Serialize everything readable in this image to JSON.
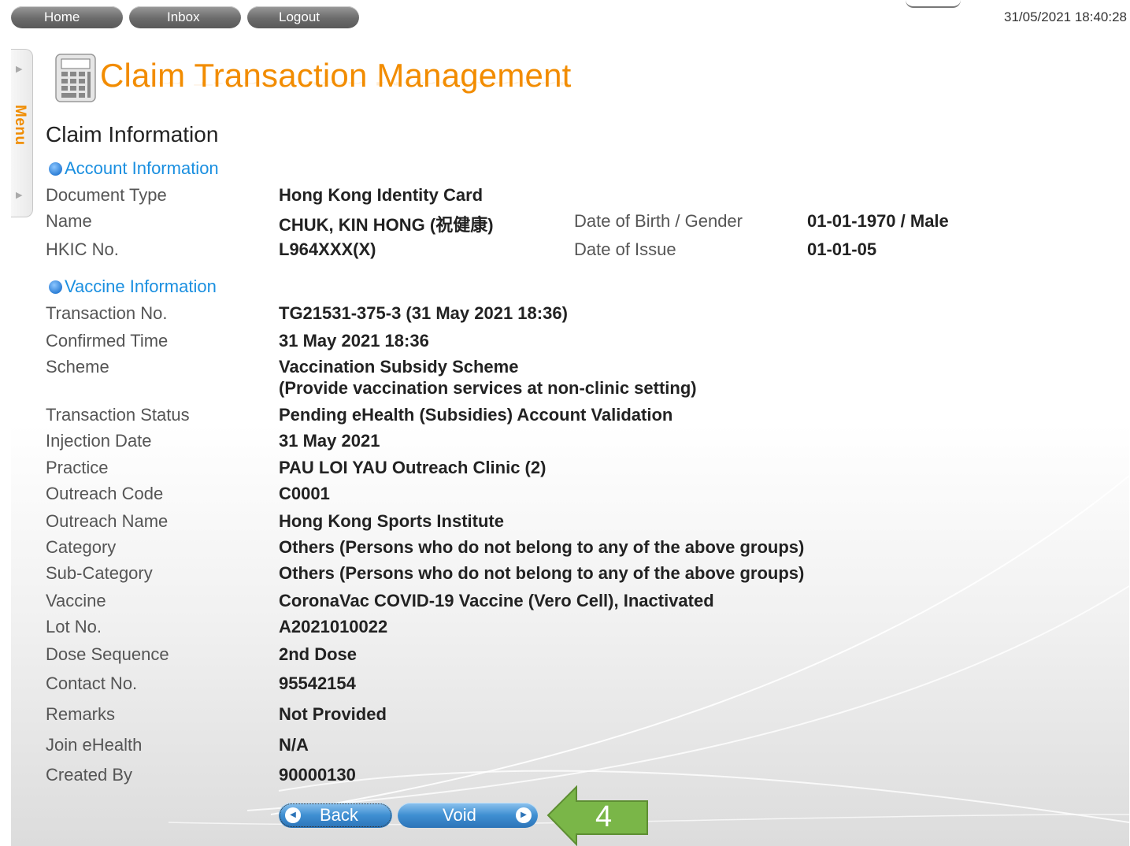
{
  "nav": {
    "home": "Home",
    "inbox": "Inbox",
    "logout": "Logout"
  },
  "datetime": "31/05/2021 18:40:28",
  "menu": {
    "label": "Menu"
  },
  "page_title": "Claim Transaction Management",
  "section": "Claim Information",
  "account": {
    "heading": "Account Information",
    "document_type_label": "Document Type",
    "document_type": "Hong Kong Identity Card",
    "name_label": "Name",
    "name": "CHUK, KIN HONG (祝健康)",
    "dob_gender_label": "Date of Birth / Gender",
    "dob_gender": "01-01-1970 / Male",
    "hkic_label": "HKIC No.",
    "hkic": "L964XXX(X)",
    "doi_label": "Date of Issue",
    "doi": "01-01-05"
  },
  "vaccine": {
    "heading": "Vaccine Information",
    "transaction_no_label": "Transaction No.",
    "transaction_no": "TG21531-375-3 (31 May 2021 18:36)",
    "confirmed_time_label": "Confirmed Time",
    "confirmed_time": "31 May 2021 18:36",
    "scheme_label": "Scheme",
    "scheme_line1": "Vaccination Subsidy Scheme",
    "scheme_line2": "(Provide vaccination services at non-clinic setting)",
    "status_label": "Transaction Status",
    "status": "Pending eHealth (Subsidies) Account Validation",
    "injection_date_label": "Injection Date",
    "injection_date": "31 May 2021",
    "practice_label": "Practice",
    "practice": "PAU LOI YAU Outreach Clinic (2)",
    "outreach_code_label": "Outreach Code",
    "outreach_code": "C0001",
    "outreach_name_label": "Outreach Name",
    "outreach_name": "Hong Kong Sports Institute",
    "category_label": "Category",
    "category": "Others (Persons who do not belong to any of the above groups)",
    "subcategory_label": "Sub-Category",
    "subcategory": "Others (Persons who do not belong to any of the above groups)",
    "vaccine_label": "Vaccine",
    "vaccine": "CoronaVac COVID-19 Vaccine (Vero Cell), Inactivated",
    "lot_label": "Lot No.",
    "lot": "A2021010022",
    "dose_label": "Dose Sequence",
    "dose": "2nd Dose",
    "contact_label": "Contact No.",
    "contact": "95542154",
    "remarks_label": "Remarks",
    "remarks": "Not Provided",
    "join_label": "Join eHealth",
    "join": "N/A",
    "created_by_label": "Created By",
    "created_by": "90000130"
  },
  "buttons": {
    "back": "Back",
    "void": "Void"
  },
  "annotation": {
    "number": "4"
  },
  "colors": {
    "title": "#f28c00",
    "link": "#1a8fe0",
    "button": "#3f8fd2",
    "annotation_arrow": "#7ab648"
  }
}
